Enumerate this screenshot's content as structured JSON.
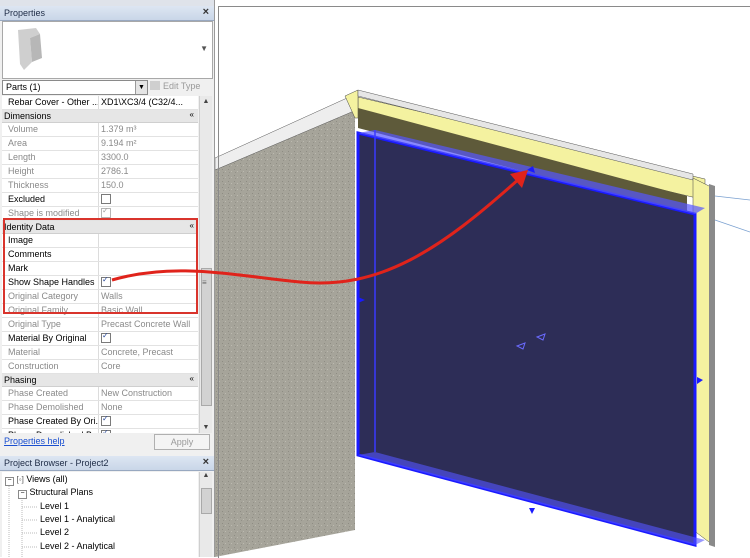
{
  "properties": {
    "title": "Properties",
    "selector_value": "Parts (1)",
    "edit_type_label": "Edit Type",
    "rebar_row": {
      "key": "Rebar Cover - Other ...",
      "value": "XD1\\XC3/4 (C32/4..."
    },
    "groups": {
      "dimensions": "Dimensions",
      "identity": "Identity Data",
      "phasing": "Phasing"
    },
    "dimensions": [
      {
        "key": "Volume",
        "value": "1.379 m³"
      },
      {
        "key": "Area",
        "value": "9.194 m²"
      },
      {
        "key": "Length",
        "value": "3300.0"
      },
      {
        "key": "Height",
        "value": "2786.1"
      },
      {
        "key": "Thickness",
        "value": "150.0"
      },
      {
        "key": "Excluded",
        "checked": false
      },
      {
        "key": "Shape is modified",
        "checked": true
      }
    ],
    "identity": [
      {
        "key": "Image",
        "value": ""
      },
      {
        "key": "Comments",
        "value": ""
      },
      {
        "key": "Mark",
        "value": ""
      },
      {
        "key": "Show Shape Handles",
        "checked": true
      },
      {
        "key": "Original Category",
        "value": "Walls"
      },
      {
        "key": "Original Family",
        "value": "Basic Wall"
      },
      {
        "key": "Original Type",
        "value": "Precast Concrete Wall"
      },
      {
        "key": "Material By Original",
        "checked": true
      },
      {
        "key": "Material",
        "value": "Concrete, Precast"
      },
      {
        "key": "Construction",
        "value": "Core"
      }
    ],
    "phasing": [
      {
        "key": "Phase Created",
        "value": "New Construction"
      },
      {
        "key": "Phase Demolished",
        "value": "None"
      },
      {
        "key": "Phase Created By Ori...",
        "checked": true
      },
      {
        "key": "Phase Demolished B...",
        "checked": true
      }
    ],
    "help_link": "Properties help",
    "apply_label": "Apply"
  },
  "browser": {
    "title": "Project Browser - Project2",
    "items": [
      {
        "label": "Views (all)"
      },
      {
        "label": "Structural Plans"
      },
      {
        "label": "Level 1"
      },
      {
        "label": "Level 1 - Analytical"
      },
      {
        "label": "Level 2"
      },
      {
        "label": "Level 2 - Analytical"
      }
    ]
  },
  "colors": {
    "highlight_box": "#d9342c",
    "arrow": "#e0231b",
    "selection": "#1a1aff",
    "wall_fill": "#2d2d57",
    "insulation": "#f4f2a0",
    "concrete": "#a6a49a"
  }
}
